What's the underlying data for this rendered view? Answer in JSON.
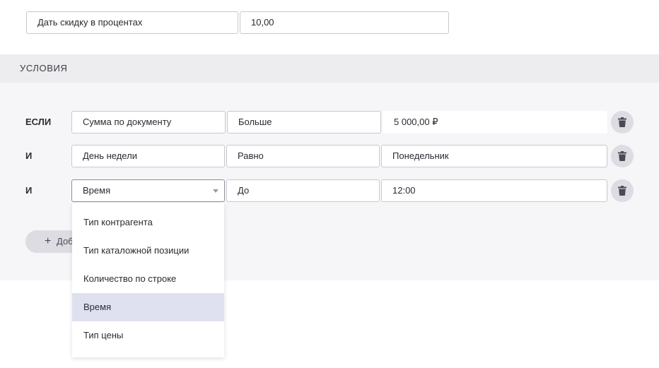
{
  "discount": {
    "type_value": "Дать скидку в процентах",
    "amount_value": "10,00"
  },
  "conditions_section": {
    "title": "УСЛОВИЯ",
    "rows": [
      {
        "label": "ЕСЛИ",
        "field": "Сумма по документу",
        "operator": "Больше",
        "value": "5 000,00 ₽"
      },
      {
        "label": "И",
        "field": "День недели",
        "operator": "Равно",
        "value": "Понедельник"
      },
      {
        "label": "И",
        "field": "Время",
        "operator": "До",
        "value": "12:00"
      }
    ],
    "add_button_label": "Доб"
  },
  "dropdown": {
    "items": [
      "Тип контрагента",
      "Тип каталожной позиции",
      "Количество по строке",
      "Время",
      "Тип цены"
    ],
    "selected": "Время"
  },
  "icons": {
    "delete": "trash-icon",
    "add": "plus-icon",
    "dropdown": "caret-down-icon"
  },
  "colors": {
    "section_header_bg": "#ededf0",
    "section_body_bg": "#f6f6f8",
    "selected_item_bg": "#dfe1f1",
    "button_bg": "#dcdce2"
  }
}
